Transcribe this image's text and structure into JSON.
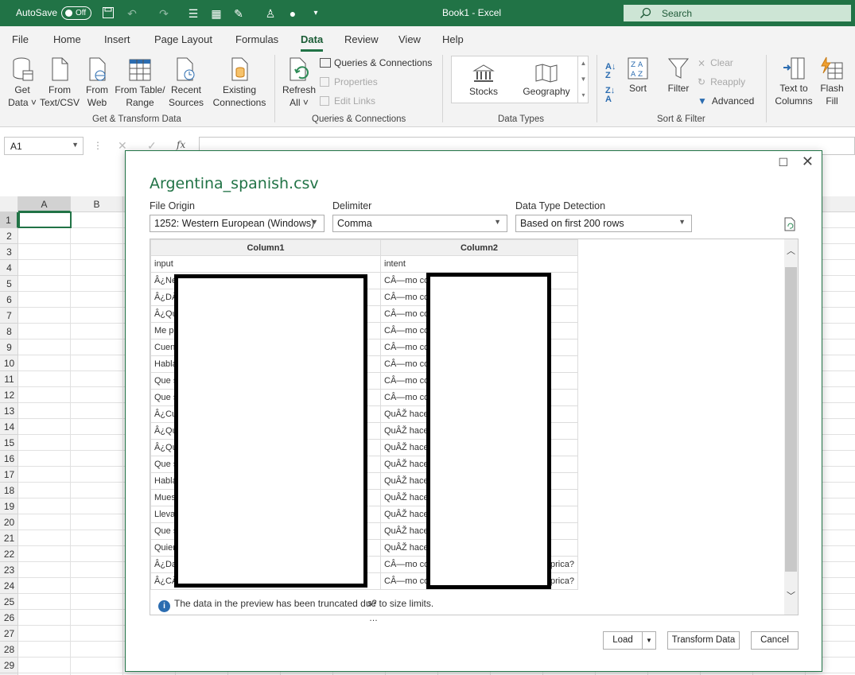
{
  "titlebar": {
    "autosave_label": "AutoSave",
    "toggle_state": "Off",
    "title": "Book1  -  Excel",
    "search_placeholder": "Search"
  },
  "tabs": [
    "File",
    "Home",
    "Insert",
    "Page Layout",
    "Formulas",
    "Data",
    "Review",
    "View",
    "Help"
  ],
  "active_tab": "Data",
  "ribbon": {
    "get_transform": {
      "group_label": "Get & Transform Data",
      "get_data": [
        "Get",
        "Data ˅"
      ],
      "from_text_csv": [
        "From",
        "Text/CSV"
      ],
      "from_web": [
        "From",
        "Web"
      ],
      "from_table_range": [
        "From Table/",
        "Range"
      ],
      "recent_sources": [
        "Recent",
        "Sources"
      ],
      "existing_connections": [
        "Existing",
        "Connections"
      ]
    },
    "queries": {
      "group_label": "Queries & Connections",
      "refresh_all": [
        "Refresh",
        "All ˅"
      ],
      "queries_connections": "Queries & Connections",
      "properties": "Properties",
      "edit_links": "Edit Links"
    },
    "data_types": {
      "group_label": "Data Types",
      "stocks": "Stocks",
      "geography": "Geography"
    },
    "sort_filter": {
      "group_label": "Sort & Filter",
      "sort": "Sort",
      "filter": "Filter",
      "clear": "Clear",
      "reapply": "Reapply",
      "advanced": "Advanced"
    },
    "data_tools": {
      "text_to_columns": [
        "Text to",
        "Columns"
      ],
      "flash_fill": [
        "Flash",
        "Fill"
      ]
    }
  },
  "formula_bar": {
    "name_box": "A1",
    "fx": "fx"
  },
  "sheet": {
    "columns": [
      "A",
      "B"
    ],
    "rows": [
      "1",
      "2",
      "3",
      "4",
      "5",
      "6",
      "7",
      "8",
      "9",
      "10",
      "11",
      "12",
      "13",
      "14",
      "15",
      "16",
      "17",
      "18",
      "19",
      "20",
      "21",
      "22",
      "23",
      "24",
      "25",
      "26",
      "27",
      "28",
      "29"
    ]
  },
  "dialog": {
    "title": "Argentina_spanish.csv",
    "file_origin": {
      "label": "File Origin",
      "value": "1252: Western European (Windows)"
    },
    "delimiter": {
      "label": "Delimiter",
      "value": "Comma"
    },
    "detection": {
      "label": "Data Type Detection",
      "value": "Based on first 200 rows"
    },
    "columns": [
      "Column1",
      "Column2"
    ],
    "rows": [
      [
        "input",
        "intent"
      ],
      [
        "Â¿Ne",
        "CÂ—mo co"
      ],
      [
        "Â¿DÂ",
        "CÂ—mo co"
      ],
      [
        "Â¿Qu",
        "CÂ—mo co"
      ],
      [
        "Me p",
        "CÂ—mo co"
      ],
      [
        "Cuen",
        "CÂ—mo co"
      ],
      [
        "Habla",
        "CÂ—mo co"
      ],
      [
        "Que s",
        "CÂ—mo co"
      ],
      [
        "Que s",
        "CÂ—mo co"
      ],
      [
        "Â¿Cu",
        "QuÂŽ hace"
      ],
      [
        "Â¿Qu",
        "QuÂŽ hace"
      ],
      [
        "Â¿Qu",
        "QuÂŽ hace"
      ],
      [
        "Que s",
        "QuÂŽ hace"
      ],
      [
        "Habla",
        "QuÂŽ hace"
      ],
      [
        "Mues",
        "QuÂŽ hace"
      ],
      [
        "Lleva",
        "QuÂŽ hace"
      ],
      [
        "Que s",
        "QuÂŽ hace"
      ],
      [
        "Quier",
        "QuÂŽ hace"
      ],
      [
        "Â¿Da",
        "CÂ—mo co"
      ],
      [
        "Â¿CÂ",
        "CÂ—mo co"
      ]
    ],
    "tail_fragments": {
      "row17_col1": "s?",
      "row18_col1": "…",
      "row19_col2": "prica?",
      "row20_col2": "prica?"
    },
    "truncation_note": "The data in the preview has been truncated due to size limits.",
    "buttons": {
      "load": "Load",
      "transform": "Transform Data",
      "cancel": "Cancel"
    }
  }
}
